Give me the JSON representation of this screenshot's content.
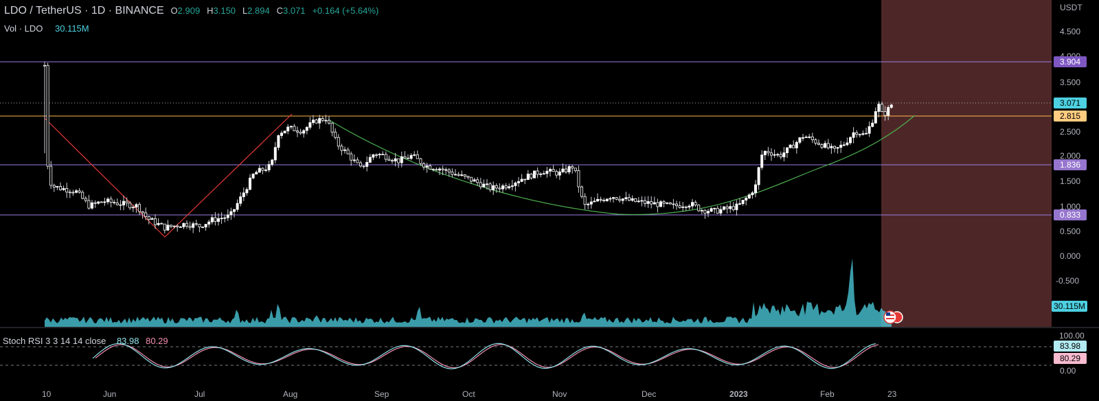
{
  "header": {
    "symbol": "LDO / TetherUS · 1D · BINANCE",
    "open_label": "O",
    "open": "2.909",
    "high_label": "H",
    "high": "3.150",
    "low_label": "L",
    "low": "2.894",
    "close_label": "C",
    "close": "3.071",
    "change": "+0.164 (+5.64%)",
    "vol_label": "Vol · LDO",
    "vol_value": "30.115M"
  },
  "rsi_header": {
    "label": "Stoch RSI 3 3 14 14 close",
    "k": "83.98",
    "d": "80.29"
  },
  "price_axis": {
    "unit": "USDT",
    "ticks": [
      "4.500",
      "4.000",
      "3.500",
      "2.500",
      "2.000",
      "1.500",
      "1.000",
      "0.500",
      "0.000",
      "-0.500"
    ]
  },
  "rsi_axis": {
    "ticks": [
      "100.00",
      "0.00"
    ]
  },
  "price_labels": {
    "l3904": "3.904",
    "last": "3.071",
    "l2815": "2.815",
    "l1836": "1.836",
    "l0833": "0.833",
    "volume": "30.115M",
    "k": "83.98",
    "d": "80.29"
  },
  "time_axis": [
    "10",
    "Jun",
    "Jul",
    "Aug",
    "Sep",
    "Oct",
    "Nov",
    "Dec",
    "2023",
    "Feb",
    "23"
  ],
  "colors": {
    "up": "#26a69a",
    "down": "#ef5350",
    "candle_up": "#ffffff",
    "candle_down": "#ffffff",
    "level_purple": "#9c7ce8",
    "level_orange": "#ffb74d",
    "last_price": "#4dd0e1",
    "volume": "#4dd0e1",
    "rsi_k": "#8fe3ea",
    "rsi_d": "#f48fb1",
    "zone": "#5b2e2e"
  },
  "chart_data": {
    "type": "candlestick",
    "title": "LDO / TetherUS · 1D · BINANCE",
    "ylabel": "USDT",
    "ylim": [
      -0.9,
      4.85
    ],
    "horizontal_levels": [
      3.904,
      3.071,
      2.815,
      1.836,
      0.833
    ],
    "x": [
      "May 10",
      "Jun",
      "Jul",
      "Aug",
      "Sep",
      "Oct",
      "Nov",
      "Dec",
      "2023",
      "Feb",
      "Feb 23"
    ],
    "close": [
      1.3,
      0.9,
      0.62,
      2.4,
      1.9,
      1.55,
      1.8,
      1.0,
      0.95,
      2.35,
      3.071
    ],
    "last_ohlc": {
      "open": 2.909,
      "high": 3.15,
      "low": 2.894,
      "close": 3.071,
      "change": 0.164,
      "change_pct": 5.64
    },
    "volume_last": "30.115M",
    "stoch_rsi": {
      "k": 83.98,
      "d": 80.29,
      "upper": 80,
      "lower": 20
    }
  }
}
